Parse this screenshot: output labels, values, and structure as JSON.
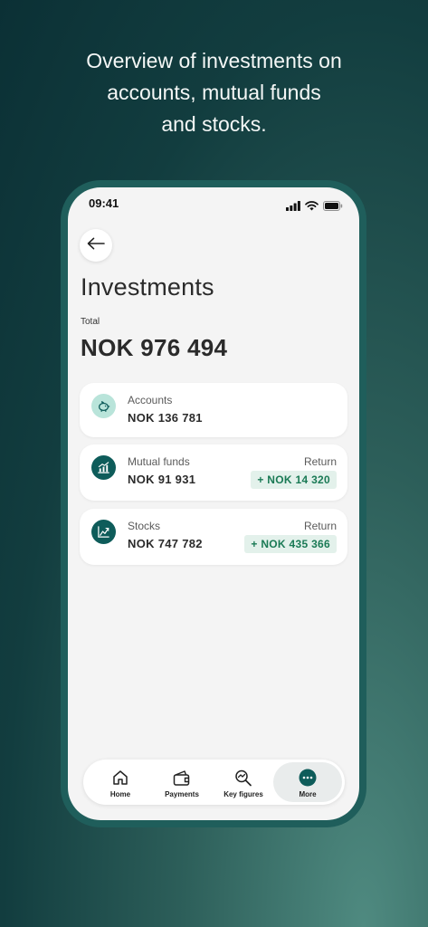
{
  "headline": {
    "line1": "Overview of investments on",
    "line2": "accounts, mutual funds",
    "line3": "and stocks."
  },
  "status_bar": {
    "time": "09:41"
  },
  "page": {
    "title": "Investments",
    "total_label": "Total",
    "total_value": "NOK 976 494"
  },
  "cards": [
    {
      "label": "Accounts",
      "amount": "NOK 136 781",
      "icon": "piggy-bank-icon"
    },
    {
      "label": "Mutual funds",
      "amount": "NOK 91 931",
      "return_label": "Return",
      "return_value": "+ NOK 14 320",
      "icon": "fund-chart-icon"
    },
    {
      "label": "Stocks",
      "amount": "NOK 747 782",
      "return_label": "Return",
      "return_value": "+ NOK 435 366",
      "icon": "stocks-chart-icon"
    }
  ],
  "bottom_nav": {
    "items": [
      {
        "label": "Home",
        "icon": "home-icon"
      },
      {
        "label": "Payments",
        "icon": "wallet-icon"
      },
      {
        "label": "Key figures",
        "icon": "key-figures-icon"
      },
      {
        "label": "More",
        "icon": "more-icon",
        "active": true
      }
    ]
  },
  "colors": {
    "accent_dark": "#0e5c5a",
    "accent_light": "#b9e4da",
    "positive_text": "#1a7a55",
    "positive_bg": "#e3f1eb"
  }
}
